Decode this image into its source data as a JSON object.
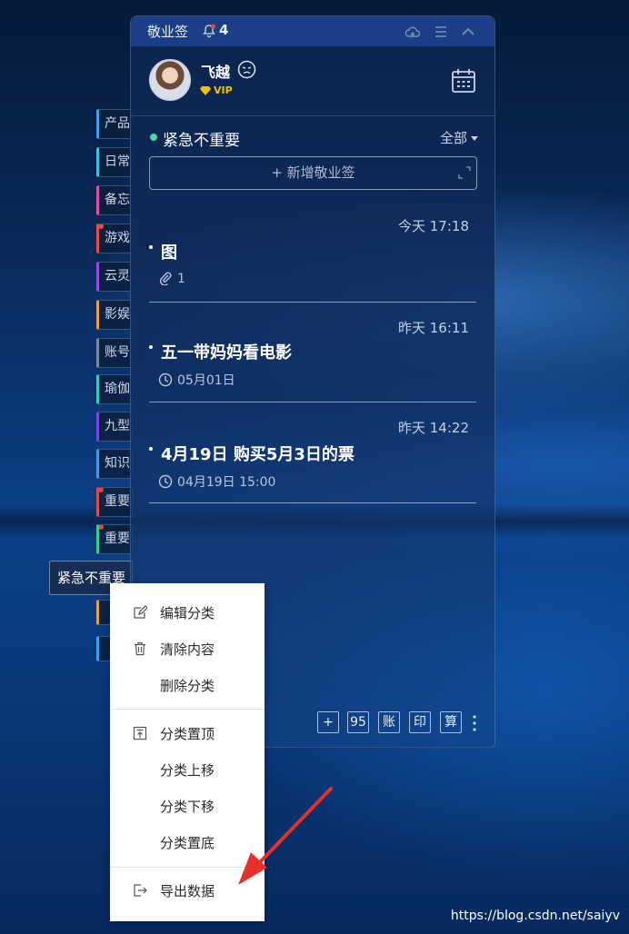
{
  "sidebar": {
    "tabs": [
      {
        "label": "产品",
        "color": "#3ea0e8",
        "dot": false
      },
      {
        "label": "日常",
        "color": "#3ec0e8",
        "dot": false
      },
      {
        "label": "备忘",
        "color": "#e84aa8",
        "dot": false
      },
      {
        "label": "游戏",
        "color": "#e84a4a",
        "dot": true
      },
      {
        "label": "云灵",
        "color": "#9a4ae8",
        "dot": false
      },
      {
        "label": "影娱",
        "color": "#e8a03e",
        "dot": false
      },
      {
        "label": "账号",
        "color": "#7a8aa0",
        "dot": false
      },
      {
        "label": "瑜伽",
        "color": "#3ec8c0",
        "dot": false
      },
      {
        "label": "九型",
        "color": "#7a4ae8",
        "dot": false
      },
      {
        "label": "知识",
        "color": "#4a9ae8",
        "dot": false
      },
      {
        "label": "重要",
        "color": "#e84a3a",
        "dot": true
      },
      {
        "label": "重要",
        "color": "#3ec88a",
        "dot": true
      }
    ],
    "active_tab": "紧急不重要"
  },
  "widget": {
    "app_title": "敬业签",
    "notification_count": "4",
    "user": {
      "name": "飞越",
      "badge": "VIP"
    },
    "category": {
      "name": "紧急不重要",
      "dot_color": "#52d3a8",
      "filter": "全部"
    },
    "add_placeholder": "+ 新增敬业签",
    "notes": [
      {
        "time": "今天 17:18",
        "title": "图",
        "meta": "1",
        "meta_icon": "paperclip-icon"
      },
      {
        "time": "昨天 16:11",
        "title": "五一带妈妈看电影",
        "meta": "05月01日",
        "meta_icon": "clock-icon"
      },
      {
        "time": "昨天 14:22",
        "title": "4月19日 购买5月3日的票",
        "meta": "04月19日 15:00",
        "meta_icon": "clock-icon"
      }
    ],
    "bottom_buttons": [
      "+",
      "95",
      "账",
      "印",
      "算"
    ]
  },
  "context_menu": {
    "group1": [
      "编辑分类",
      "清除内容",
      "删除分类"
    ],
    "group2": [
      "分类置顶",
      "分类上移",
      "分类下移",
      "分类置底"
    ],
    "group3": [
      "导出数据"
    ]
  },
  "watermark": "https://blog.csdn.net/saiyv",
  "colors": {
    "accent": "#1a3f86",
    "alert": "#e84a3a",
    "arrow": "#e8302a"
  }
}
